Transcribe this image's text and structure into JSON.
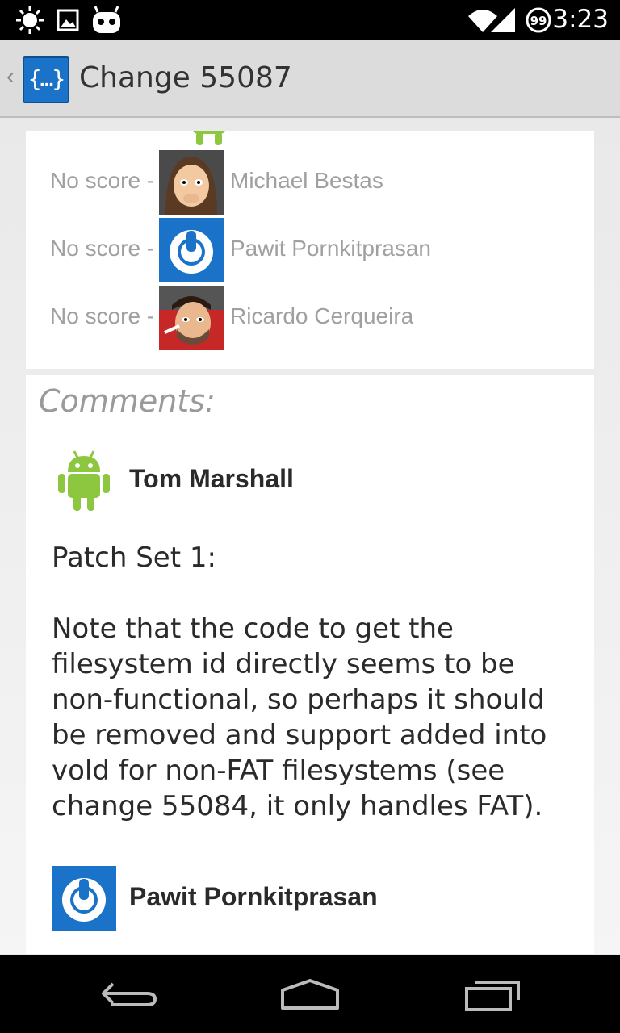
{
  "status_bar": {
    "icons": [
      "brightness-icon",
      "image-icon",
      "cyanogen-bot-icon",
      "wifi-icon",
      "signal-icon",
      "notification-count-icon"
    ],
    "notification_count": "99",
    "time": "3:23"
  },
  "action_bar": {
    "title": "Change 55087"
  },
  "reviewers": [
    {
      "score": "No score -",
      "name": "Michael Bestas",
      "avatar": "cartoon-avatar"
    },
    {
      "score": "No score -",
      "name": "Pawit Pornkitprasan",
      "avatar": "gerrit-power-avatar"
    },
    {
      "score": "No score -",
      "name": "Ricardo Cerqueira",
      "avatar": "cartoon-avatar"
    }
  ],
  "comments": {
    "heading": "Comments:",
    "items": [
      {
        "author": "Tom Marshall",
        "avatar": "android-avatar",
        "patch_set": "Patch Set 1:",
        "text": "Note that the code to get the filesystem id directly seems to be non-functional, so perhaps it should be removed and support added into vold for non-FAT filesystems (see change 55084, it only handles FAT)."
      },
      {
        "author": "Pawit Pornkitprasan",
        "avatar": "gerrit-power-avatar"
      }
    ]
  },
  "colors": {
    "accent": "#1a73c8",
    "android_green": "#8dc63f"
  }
}
